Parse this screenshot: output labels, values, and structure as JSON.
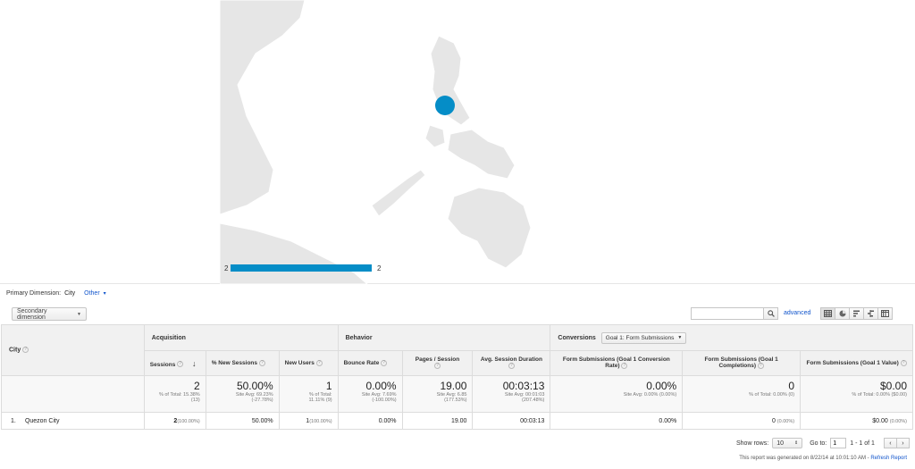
{
  "map": {
    "legend_min": "2",
    "legend_max": "2",
    "bubble_color": "#058dc7"
  },
  "dimension": {
    "label": "Primary Dimension:",
    "active": "City",
    "other": "Other"
  },
  "toolbar": {
    "secondary_dimension": "Secondary dimension",
    "search_placeholder": "",
    "advanced": "advanced",
    "view_icons": [
      "grid-view-icon",
      "pie-view-icon",
      "performance-view-icon",
      "comparison-view-icon",
      "pivot-view-icon"
    ]
  },
  "table": {
    "city_header": "City",
    "groups": {
      "acquisition": "Acquisition",
      "behavior": "Behavior",
      "conversions": "Conversions",
      "goal_select": "Goal 1: Form Submissions"
    },
    "columns": {
      "sessions": "Sessions",
      "new_sessions": "% New Sessions",
      "new_users": "New Users",
      "bounce_rate": "Bounce Rate",
      "pages_session": "Pages / Session",
      "avg_duration": "Avg. Session Duration",
      "conv_rate": "Form Submissions (Goal 1 Conversion Rate)",
      "completions": "Form Submissions (Goal 1 Completions)",
      "value": "Form Submissions (Goal 1 Value)"
    },
    "totals": {
      "sessions": "2",
      "sessions_sub": "% of Total: 15.38%",
      "sessions_sub2": "(13)",
      "new_sessions": "50.00%",
      "new_sessions_sub": "Site Avg: 69.23%",
      "new_sessions_sub2": "(-27.78%)",
      "new_users": "1",
      "new_users_sub": "% of Total:",
      "new_users_sub2": "11.11% (9)",
      "bounce_rate": "0.00%",
      "bounce_rate_sub": "Site Avg: 7.69%",
      "bounce_rate_sub2": "(-100.00%)",
      "pages_session": "19.00",
      "pages_session_sub": "Site Avg: 6.85",
      "pages_session_sub2": "(177.53%)",
      "avg_duration": "00:03:13",
      "avg_duration_sub": "Site Avg: 00:01:03",
      "avg_duration_sub2": "(207.48%)",
      "conv_rate": "0.00%",
      "conv_rate_sub": "Site Avg: 0.00% (0.00%)",
      "completions": "0",
      "completions_sub": "% of Total: 0.00% (0)",
      "value": "$0.00",
      "value_sub": "% of Total: 0.00% ($0.00)"
    },
    "rows": [
      {
        "index": "1.",
        "city": "Quezon City",
        "sessions": "2",
        "sessions_pct": "(100.00%)",
        "new_sessions": "50.00%",
        "new_users": "1",
        "new_users_pct": "(100.00%)",
        "bounce_rate": "0.00%",
        "pages_session": "19.00",
        "avg_duration": "00:03:13",
        "conv_rate": "0.00%",
        "completions": "0",
        "completions_pct": "(0.00%)",
        "value": "$0.00",
        "value_pct": "(0.00%)"
      }
    ]
  },
  "footer": {
    "show_rows_label": "Show rows:",
    "show_rows_value": "10",
    "goto_label": "Go to:",
    "goto_value": "1",
    "range": "1 - 1 of 1",
    "generated": "This report was generated on 8/22/14 at 10:01:10 AM -",
    "refresh": "Refresh Report"
  }
}
